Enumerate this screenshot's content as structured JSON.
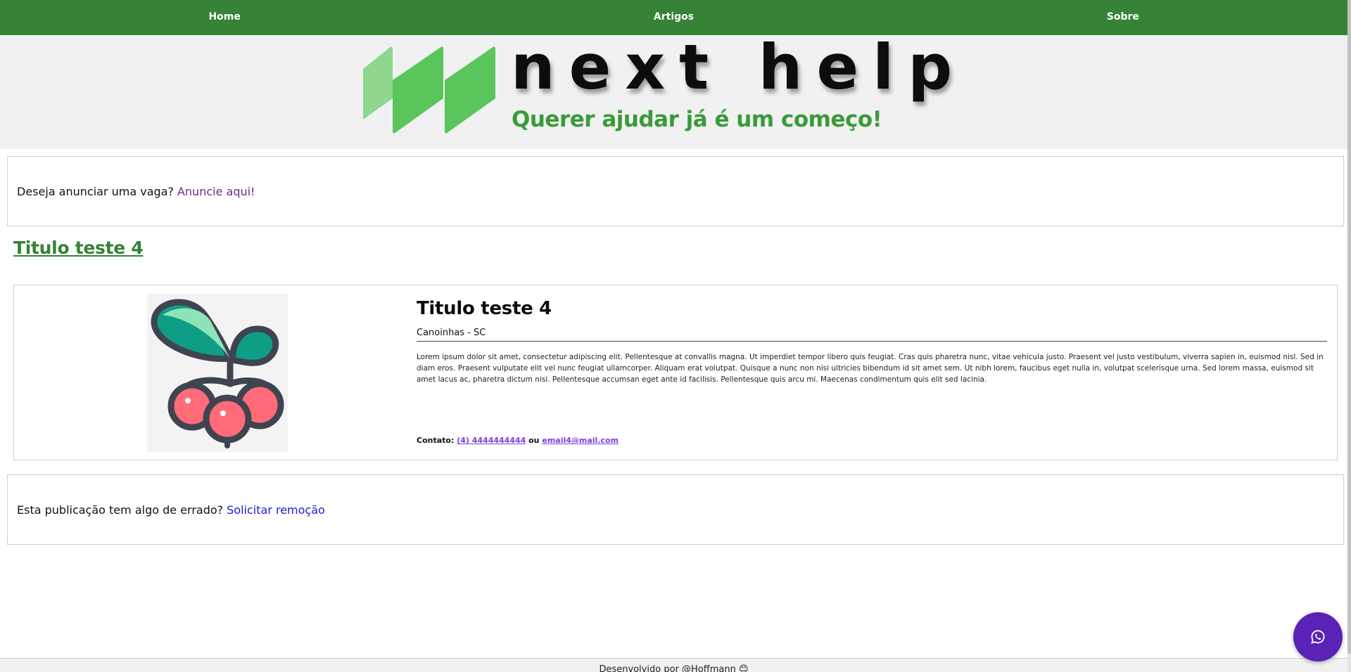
{
  "nav": {
    "home": "Home",
    "articles": "Artigos",
    "about": "Sobre"
  },
  "brand": {
    "name": "next help",
    "tagline": "Querer ajudar já é um começo!",
    "colors": {
      "primary": "#368236",
      "accent": "#5b22b8",
      "logo_green": "#5ac55a"
    }
  },
  "announce": {
    "question": "Deseja anunciar uma vaga?",
    "link": "Anuncie aqui!"
  },
  "page": {
    "title": "Titulo teste 4"
  },
  "card": {
    "image_icon": "berries-icon",
    "title": "Titulo teste 4",
    "location": "Canoinhas - SC",
    "description": "Lorem ipsum dolor sit amet, consectetur adipiscing elit. Pellentesque at convallis magna. Ut imperdiet tempor libero quis feugiat. Cras quis pharetra nunc, vitae vehicula justo. Praesent vel justo vestibulum, viverra sapien in, euismod nisl. Sed in diam eros. Praesent vulputate elit vel nunc feugiat ullamcorper. Aliquam erat volutpat. Quisque a nunc non nisi ultricies bibendum id sit amet sem. Ut nibh lorem, faucibus eget nulla in, volutpat scelerisque urna. Sed lorem massa, euismod sit amet lacus ac, pharetra dictum nisi. Pellentesque accumsan eget ante id facilisis. Pellentesque quis arcu mi. Maecenas condimentum quis elit sed lacinia.",
    "contact_label": "Contato:",
    "phone": "(4) 4444444444",
    "or": "ou",
    "email": "email4@mail.com"
  },
  "report": {
    "question": "Esta publicação tem algo de errado?",
    "link": "Solicitar remoção"
  },
  "footer": {
    "text": "Desenvolvido por @Hoffmann 😊"
  },
  "fab": {
    "icon": "whatsapp-icon"
  }
}
